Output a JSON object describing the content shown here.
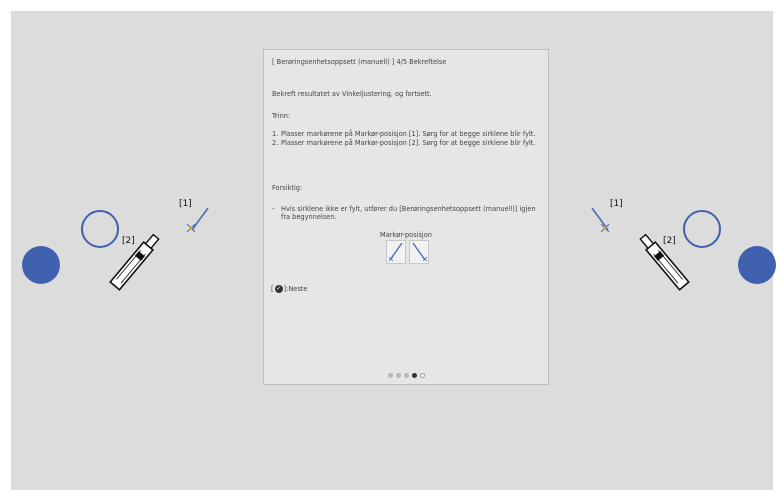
{
  "panel": {
    "title": "[ Berøringsenhetsoppsett (manuell) ]  4/5 Bekreftelse",
    "intro": "Bekreft resultatet av Vinkeljustering, og fortsett.",
    "steps_heading": "Trinn:",
    "steps": [
      {
        "num": "1.",
        "text": "Plasser markørene på Markør-posisjon [1]. Sørg for at begge sirklene blir fylt."
      },
      {
        "num": "2.",
        "text": "Plasser markørene på Markør-posisjon [2]. Sørg for at begge sirklene blir fylt."
      }
    ],
    "caution_heading": "Forsiktig:",
    "caution_dash": "-",
    "caution_text": "Hvis sirklene ikke er fylt, utfører du [Berøringsenhetsoppsett (manuell)] igjen fra begynnelsen.",
    "marker_label": "Markør-posisjon",
    "next_prefix": "[",
    "next_icon": "check-icon",
    "next_label": "]:Neste",
    "progress": {
      "total": 5,
      "current": 4
    }
  },
  "left_target": {
    "label_1": "[1]",
    "label_2": "[2]"
  },
  "right_target": {
    "label_1": "[1]",
    "label_2": "[2]"
  },
  "colors": {
    "screen_bg": "#dcdcdc",
    "panel_bg": "#e6e6e6",
    "circle": "#4060b0",
    "marker_line": "#4a6fb5",
    "cross": "#d4a020"
  }
}
